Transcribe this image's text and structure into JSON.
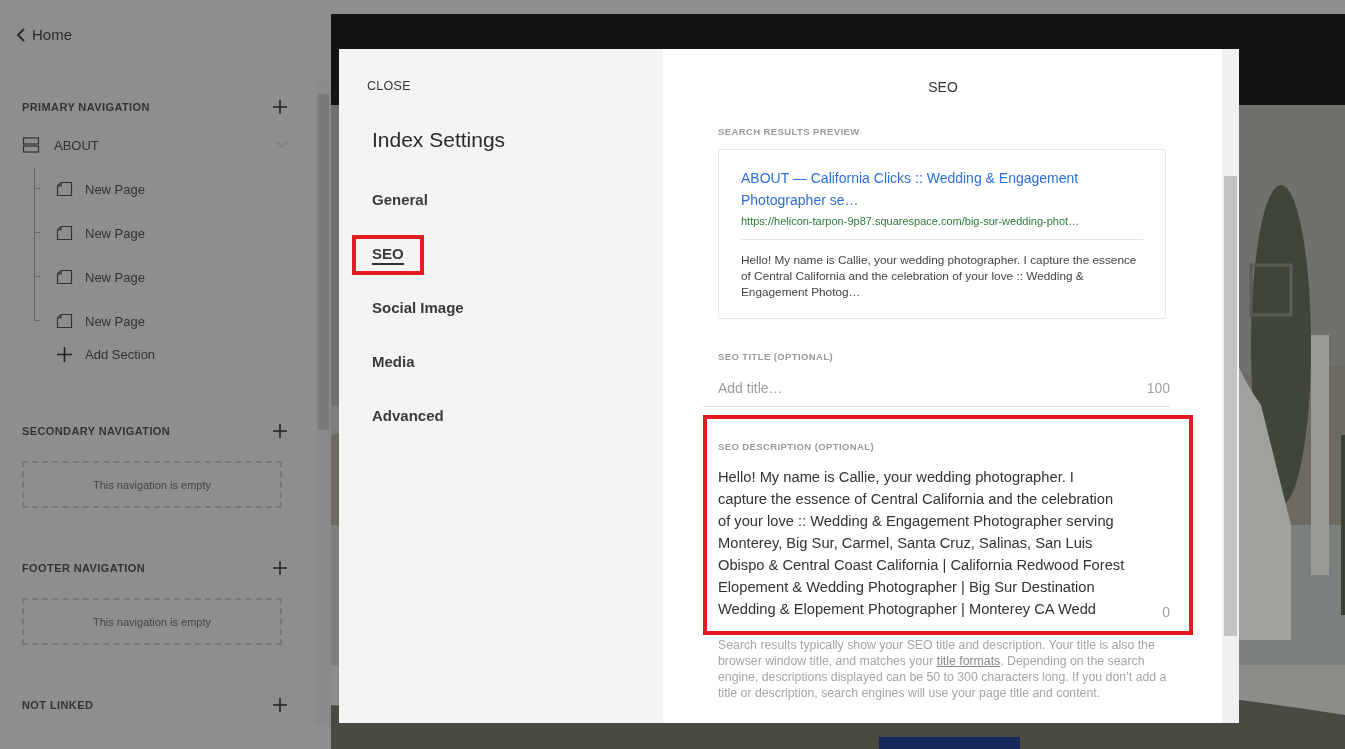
{
  "sidebar": {
    "back_link": "Home",
    "sections": [
      {
        "title": "PRIMARY NAVIGATION",
        "items": [
          {
            "label": "ABOUT",
            "kind": "folder",
            "expanded": true,
            "add_label": "Add Section",
            "children": [
              {
                "label": "New Page",
                "kind": "page"
              },
              {
                "label": "New Page",
                "kind": "page"
              },
              {
                "label": "New Page",
                "kind": "page"
              },
              {
                "label": "New Page",
                "kind": "page"
              }
            ]
          }
        ]
      },
      {
        "title": "SECONDARY NAVIGATION",
        "empty_text": "This navigation is empty"
      },
      {
        "title": "FOOTER NAVIGATION",
        "empty_text": "This navigation is empty"
      },
      {
        "title": "NOT LINKED"
      }
    ]
  },
  "modal": {
    "close": "CLOSE",
    "title": "Index Settings",
    "nav": [
      {
        "label": "General",
        "selected": false,
        "highlighted": false
      },
      {
        "label": "SEO",
        "selected": true,
        "highlighted": true
      },
      {
        "label": "Social Image",
        "selected": false,
        "highlighted": false
      },
      {
        "label": "Media",
        "selected": false,
        "highlighted": false
      },
      {
        "label": "Advanced",
        "selected": false,
        "highlighted": false
      }
    ],
    "panel_title": "SEO",
    "preview": {
      "label": "SEARCH RESULTS PREVIEW",
      "title": "ABOUT — California Clicks :: Wedding & Engagement Photographer se…",
      "url": "https://helicon-tarpon-9p87.squarespace.com/big-sur-wedding-phot…",
      "description": "Hello! My name is Callie, your wedding photographer. I capture the essence of Central California and the celebration of your love :: Wedding & Engagement Photog…"
    },
    "seo_title": {
      "label": "SEO TITLE (OPTIONAL)",
      "placeholder": "Add title…",
      "counter": "100"
    },
    "seo_description": {
      "label": "SEO DESCRIPTION (OPTIONAL)",
      "value": "Hello! My name is Callie, your wedding photographer. I capture the essence of Central California and the celebration of your love :: Wedding & Engagement Photographer serving Monterey, Big Sur, Carmel, Santa Cruz, Salinas, San Luis Obispo & Central Coast California | California Redwood Forest Elopement & Wedding Photographer | Big Sur Destination Wedding & Elopement Photographer | Monterey CA Wedd",
      "counter": "0",
      "highlighted": true
    },
    "help": {
      "before": "Search results typically show your SEO title and description. Your title is also the browser window title, and matches your ",
      "link": "title formats",
      "after": ". Depending on the search engine, descriptions displayed can be 50 to 300 characters long. If you don’t add a title or description, search engines will use your page title and content."
    }
  }
}
